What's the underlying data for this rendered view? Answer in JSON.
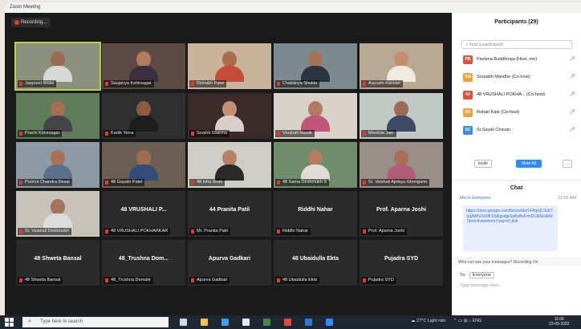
{
  "window": {
    "title": "Zoom Meeting",
    "recording_label": "Recording..."
  },
  "tiles": [
    {
      "name": "Jaspreet Walia",
      "big": "",
      "active": true,
      "bg": "#8a8f7e",
      "skin": "#9b6b4f",
      "shirt": "#d8d8d8"
    },
    {
      "name": "Saujanya Kshirsagar",
      "big": "",
      "active": false,
      "bg": "#5c4a44",
      "skin": "#b37a5c",
      "shirt": "#3b2f3f"
    },
    {
      "name": "Rishabh Patel",
      "big": "",
      "active": false,
      "bg": "#c9b39a",
      "skin": "#a86d4b",
      "shirt": "#c84b3a"
    },
    {
      "name": "Chaitanya Shukla",
      "big": "",
      "active": false,
      "bg": "#7c8a8f",
      "skin": "#a67254",
      "shirt": "#2e3340"
    },
    {
      "name": "Aayushi Kanvari",
      "big": "",
      "active": false,
      "bg": "#b9a892",
      "skin": "#c68e6e",
      "shirt": "#f0e9e0"
    },
    {
      "name": "Prachi Kshirsagar",
      "big": "",
      "active": false,
      "bg": "#5f7d5a",
      "skin": "#a87055",
      "shirt": "#444"
    },
    {
      "name": "Kartik Yerra",
      "big": "",
      "active": false,
      "bg": "#2f2f2f",
      "skin": "#8d5b41",
      "shirt": "#1e1e1e"
    },
    {
      "name": "Srushti Sharma",
      "big": "",
      "active": false,
      "bg": "#3a2a2a",
      "skin": "#c58f72",
      "shirt": "#d7cfc8"
    },
    {
      "name": "Vrushali Nayak",
      "big": "",
      "active": false,
      "bg": "#d9d2c9",
      "skin": "#b07b60",
      "shirt": "#c0557a"
    },
    {
      "name": "Mrudula Jain",
      "big": "",
      "active": false,
      "bg": "#c2c9c4",
      "skin": "#9c6b52",
      "shirt": "#3d4a66"
    },
    {
      "name": "Poorva Chandra Desai",
      "big": "",
      "active": false,
      "bg": "#8e9aa3",
      "skin": "#a97257",
      "shirt": "#5a6f88"
    },
    {
      "name": "48 Gayatri Patel",
      "big": "",
      "active": false,
      "bg": "#6b5e52",
      "skin": "#a06c4e",
      "shirt": "#344c7a"
    },
    {
      "name": "48 Isha Shah",
      "big": "",
      "active": false,
      "bg": "#d0ccc6",
      "skin": "#b68266",
      "shirt": "#2a2a2a"
    },
    {
      "name": "48 Sama Deshmukh S",
      "big": "",
      "active": false,
      "bg": "#6f8c6b",
      "skin": "#b57c5e",
      "shirt": "#e0dcd6"
    },
    {
      "name": "Sr. Vaishali Ajinkya Ghongane",
      "big": "",
      "active": false,
      "bg": "#9a8f88",
      "skin": "#a86f55",
      "shirt": "#b15d7a"
    },
    {
      "name": "Sr. Vaishali Deshmukh",
      "big": "",
      "active": false,
      "bg": "#c7c3bb",
      "skin": "#a67559",
      "shirt": "#ddd"
    },
    {
      "name": "48 VRUSHALI POKHARKAR",
      "big": "48 VRUSHALI P...",
      "active": false
    },
    {
      "name": "Mr. Pranita Patil",
      "big": "44 Pranita Patil",
      "active": false
    },
    {
      "name": "Riddhi Nahar",
      "big": "Riddhi Nahar",
      "active": false
    },
    {
      "name": "Prof. Aparna Joshi",
      "big": "Prof. Aparna Joshi",
      "active": false
    },
    {
      "name": "48 Shweta Bansal",
      "big": "48 Shweta Bansal",
      "active": false
    },
    {
      "name": "48_Trushna Domale",
      "big": "48_Trushna Dom...",
      "active": false
    },
    {
      "name": "Apurva Gadkari",
      "big": "Apurva Gadkari",
      "active": false
    },
    {
      "name": "48 Ubaidulla Ekta",
      "big": "48 Ubaidulla Ekta",
      "active": false
    },
    {
      "name": "Pujadra SYD",
      "big": "Pujadra SYD",
      "active": false
    }
  ],
  "participants_panel": {
    "title": "Participants (29)",
    "search_placeholder": "Find a participant",
    "list": [
      {
        "initials": "PB",
        "name": "Pavlena Buddhiraja (Host, me)",
        "color": "#e0533c"
      },
      {
        "initials": "SM",
        "name": "Sourabh Mandhe (Co-host)",
        "color": "#f0a13a"
      },
      {
        "initials": "4V",
        "name": "48 VRUSHALI POKHA... (Co-host)",
        "color": "#e0533c"
      },
      {
        "initials": "SK",
        "name": "Rohan Kale (Co-host)",
        "color": "#f0a13a"
      },
      {
        "initials": "SC",
        "name": "Sr.Sayali Chavan",
        "color": "#3b8de0"
      }
    ],
    "invite_label": "Invite",
    "mute_all_label": "Mute All",
    "more_label": "..."
  },
  "chat_panel": {
    "title": "Chat",
    "from": "Me to Everyone",
    "time": "11:00 AM",
    "message": "https://docs.google.com/forms/d/e/1FAIpQLScKTSqAWhCbXfKSSRgxdjpGpByBsFrmDCRkEtA8d7bo6cf/viewform?usp=sf_link",
    "share_text": "Who can see your messages? Recording On",
    "to_label": "To:",
    "to_value": "Everyone",
    "message_placeholder": "Type message here..."
  },
  "taskbar": {
    "search_placeholder": "Type here to search",
    "weather": "27°C Light rain",
    "lang": "ENG",
    "time": "11:06",
    "date": "23-09-2022"
  }
}
